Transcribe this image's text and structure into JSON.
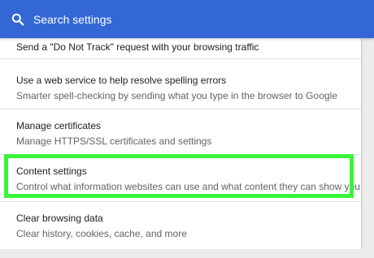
{
  "search": {
    "placeholder": "Search settings"
  },
  "settings": {
    "items": [
      {
        "title": "Send a \"Do Not Track\" request with your browsing traffic",
        "description": ""
      },
      {
        "title": "Use a web service to help resolve spelling errors",
        "description": "Smarter spell-checking by sending what you type in the browser to Google"
      },
      {
        "title": "Manage certificates",
        "description": "Manage HTTPS/SSL certificates and settings"
      },
      {
        "title": "Content settings",
        "description": "Control what information websites can use and what content they can show you"
      },
      {
        "title": "Clear browsing data",
        "description": "Clear history, cookies, cache, and more"
      }
    ]
  },
  "colors": {
    "header": "#3367d6",
    "highlight": "#39f43a",
    "card": "#ffffff",
    "background": "#ececec"
  },
  "icons": {
    "search": "search-icon"
  },
  "highlighted_item": "Content settings"
}
